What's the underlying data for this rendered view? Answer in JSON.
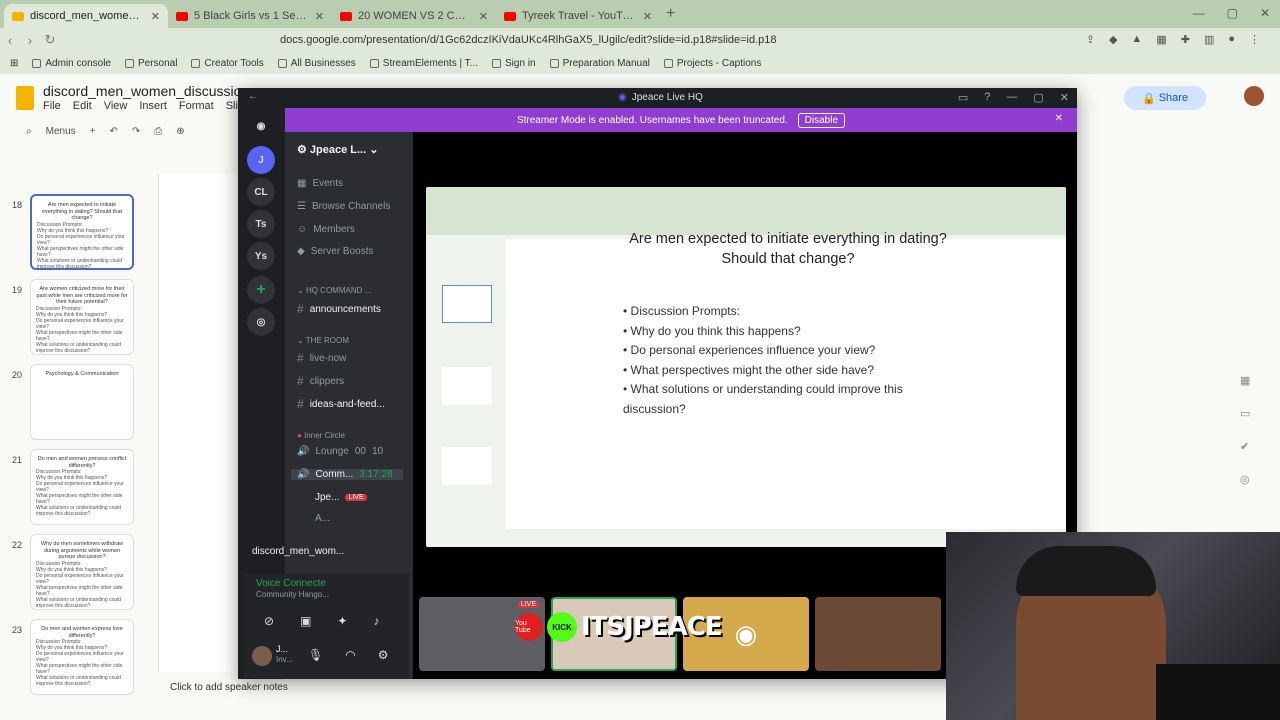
{
  "browser": {
    "tabs": [
      {
        "label": "discord_men_women_discussion",
        "color": "#f4b400",
        "active": true
      },
      {
        "label": "5 Black Girls vs 1 Secret White Girl -",
        "color": "#ff0000",
        "active": false
      },
      {
        "label": "20 WOMEN VS 2 COMEDIANS : BRO",
        "color": "#ff0000",
        "active": false
      },
      {
        "label": "Tyreek Travel - YouTube",
        "color": "#ff0000",
        "active": false
      }
    ],
    "url": "docs.google.com/presentation/d/1Gc62dczIKiVdaUKc4RlhGaX5_lUgilc/edit?slide=id.p18#slide=id.p18",
    "bookmarks": [
      "Admin console",
      "Personal",
      "Creator Tools",
      "All Businesses",
      "StreamElements | T...",
      "Sign in",
      "Preparation Manual",
      "Projects - Captions"
    ]
  },
  "slides": {
    "doc_title": "discord_men_women_discussion_nig",
    "menus": [
      "File",
      "Edit",
      "View",
      "Insert",
      "Format",
      "Slide"
    ],
    "menus_label": "Menus",
    "share_label": "Share",
    "speaker_notes": "Click to add speaker notes",
    "thumbnails": [
      {
        "num": "18",
        "title": "Are men expected to initiate everything in dating? Should that change?",
        "selected": true
      },
      {
        "num": "19",
        "title": "Are women criticized more for their past while men are criticized more for their future potential?",
        "selected": false
      },
      {
        "num": "20",
        "title": "Psychology & Communication",
        "selected": false
      },
      {
        "num": "21",
        "title": "Do men and women process conflict differently?",
        "selected": false
      },
      {
        "num": "22",
        "title": "Why do men sometimes withdraw during arguments while women pursue discussion?",
        "selected": false
      },
      {
        "num": "23",
        "title": "Do men and women express love differently?",
        "selected": false
      }
    ],
    "thumb_bullets": [
      "Discussion Prompts:",
      "Why do you think this happens?",
      "Do personal experiences influence your view?",
      "What perspectives might the other side have?",
      "What solutions or understanding could improve this discussion?"
    ]
  },
  "discord": {
    "window_title": "Jpeace Live HQ",
    "banner_text": "Streamer Mode is enabled. Usernames have been truncated.",
    "banner_button": "Disable",
    "server_name": "Jpeace L...",
    "server_icons": [
      "CL",
      "Ts",
      "Ys"
    ],
    "nav": [
      "Events",
      "Browse Channels",
      "Members",
      "Server Boosts"
    ],
    "categories": {
      "hq": "HQ COMMAND ...",
      "room": "THE ROOM",
      "inner": "Inner Circle"
    },
    "channels": {
      "announcements": "announcements",
      "live_now": "live-now",
      "clippers": "clippers",
      "ideas": "ideas-and-feed...",
      "lounge": "Lounge",
      "lounge_count_a": "00",
      "lounge_count_b": "10",
      "comm": "Comm...",
      "comm_time": "3:17:28",
      "user1": "Jpe...",
      "user2": "A...",
      "live_badge": "LIVE"
    },
    "voice": {
      "status": "Voice Connecte",
      "channel": "Community Hango..."
    },
    "stream_name": "discord_men_wom...",
    "user": {
      "name": "J...",
      "status": "Inv..."
    }
  },
  "shared_slide": {
    "title": "Are men expected to initiate everything in dating? Should that change?",
    "bullets": [
      "Discussion Prompts:",
      "Why do you think this happens?",
      "Do personal experiences influence your view?",
      "What perspectives might the other side have?",
      "What solutions or understanding could improve this discussion?"
    ],
    "tile_live": "LIVE"
  },
  "overlay": {
    "youtube": "You Tube",
    "kick": "KICK",
    "brand": "ITSJPEACE"
  }
}
